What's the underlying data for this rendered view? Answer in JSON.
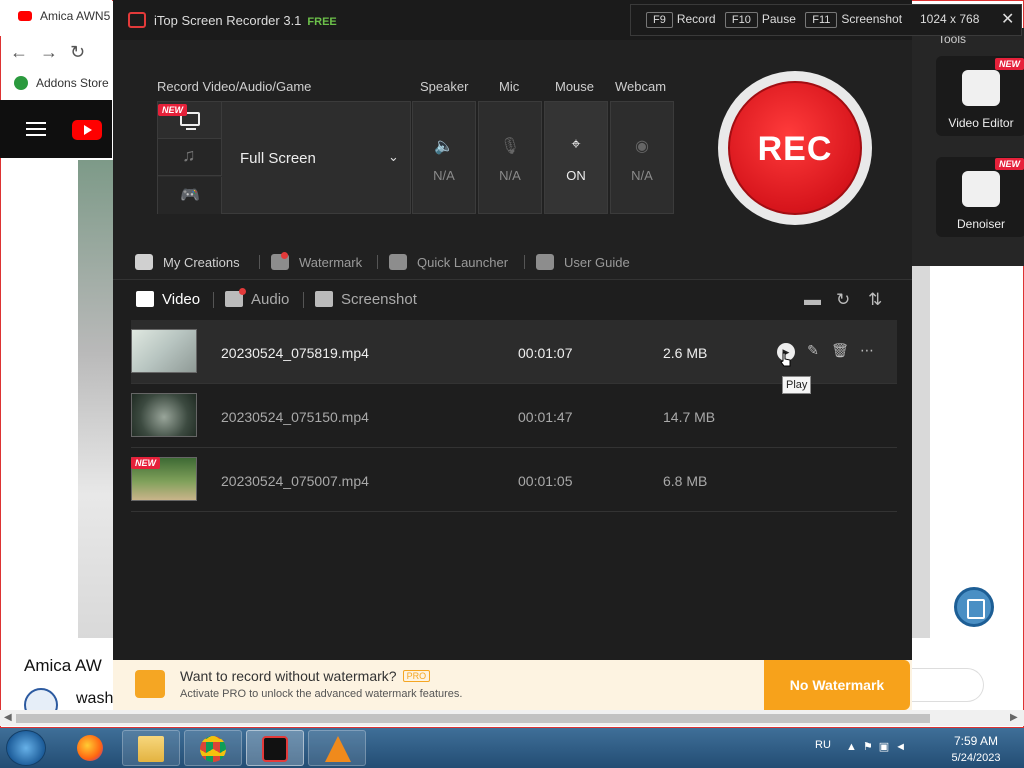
{
  "browser": {
    "tab_title": "Amica AWN5",
    "bookmark": "Addons Store",
    "page_title": "Amica AW",
    "channel_name": "wash",
    "yt_logo_text": "Y"
  },
  "tools": {
    "title": "Tools",
    "items": [
      {
        "label": "Video Editor",
        "badge": "NEW"
      },
      {
        "label": "Denoiser",
        "badge": "NEW"
      }
    ]
  },
  "recorder": {
    "title": "iTop Screen Recorder 3.1",
    "edition": "FREE",
    "hotkeys": {
      "record_key": "F9",
      "record_label": "Record",
      "pause_key": "F10",
      "pause_label": "Pause",
      "screenshot_key": "F11",
      "screenshot_label": "Screenshot",
      "resolution": "1024 x 768"
    },
    "sections": {
      "record": "Record Video/Audio/Game",
      "speaker": "Speaker",
      "mic": "Mic",
      "mouse": "Mouse",
      "webcam": "Webcam"
    },
    "mode_new_badge": "NEW",
    "capture_area": "Full Screen",
    "devices": {
      "speaker": "N/A",
      "mic": "N/A",
      "mouse": "ON",
      "webcam": "N/A"
    },
    "rec_label": "REC",
    "toolbar": {
      "creations": "My Creations",
      "watermark": "Watermark",
      "launcher": "Quick Launcher",
      "guide": "User Guide"
    },
    "list_tabs": {
      "video": "Video",
      "audio": "Audio",
      "screenshot": "Screenshot"
    },
    "files": [
      {
        "name": "20230524_075819.mp4",
        "duration": "00:01:07",
        "size": "2.6 MB",
        "badge": ""
      },
      {
        "name": "20230524_075150.mp4",
        "duration": "00:01:47",
        "size": "14.7 MB",
        "badge": ""
      },
      {
        "name": "20230524_075007.mp4",
        "duration": "00:01:05",
        "size": "6.8 MB",
        "badge": "NEW"
      }
    ],
    "tooltip": "Play",
    "promo": {
      "title": "Want to record without watermark?",
      "pro_badge": "PRO",
      "subtitle": "Activate PRO to unlock the advanced watermark features.",
      "button": "No Watermark"
    }
  },
  "taskbar": {
    "lang": "RU",
    "time": "7:59 AM",
    "date": "5/24/2023"
  },
  "colors": {
    "accent_red": "#d7151c",
    "promo_orange": "#f7a21b",
    "free_green": "#6cc04a"
  }
}
